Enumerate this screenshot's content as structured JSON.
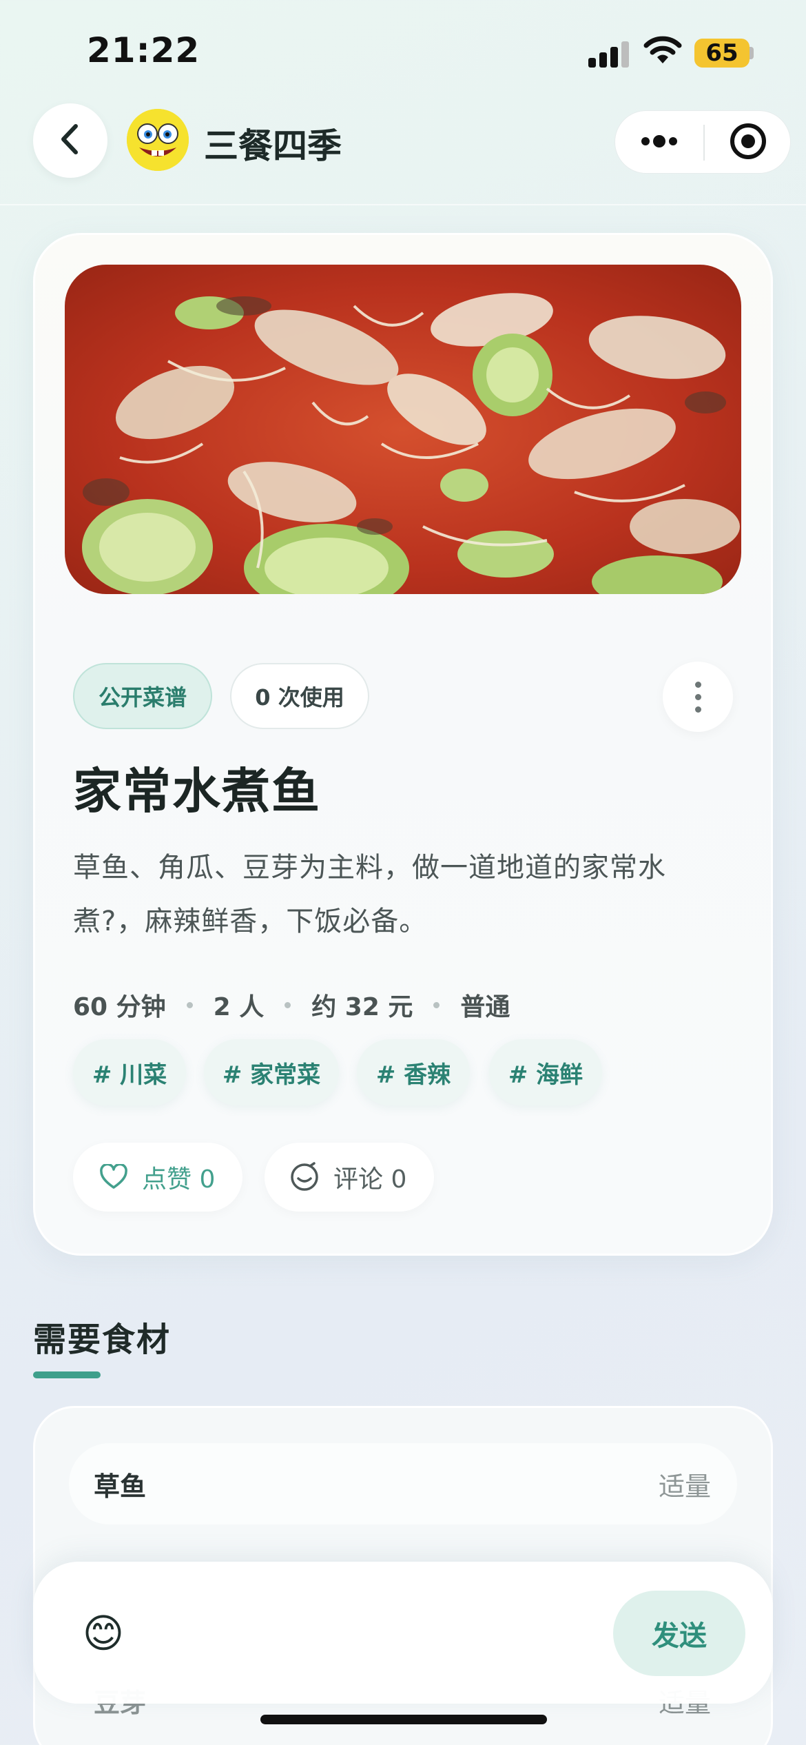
{
  "status_bar": {
    "time": "21:22",
    "battery": "65"
  },
  "nav": {
    "title": "三餐四季",
    "back_icon": "chevron-left-icon",
    "more_icon": "ellipsis-icon",
    "close_icon": "target-icon"
  },
  "recipe": {
    "visibility_badge": "公开菜谱",
    "usage_badge": "0 次使用",
    "title": "家常水煮鱼",
    "description": "草鱼、角瓜、豆芽为主料，做一道地道的家常水煮?，麻辣鲜香，下饭必备。",
    "meta": {
      "time": "60 分钟",
      "servings": "2 人",
      "cost": "约 32 元",
      "difficulty": "普通"
    },
    "tags": [
      "# 川菜",
      "# 家常菜",
      "# 香辣",
      "# 海鲜"
    ],
    "like_label": "点赞 0",
    "comment_label": "评论 0"
  },
  "ingredients": {
    "title": "需要食材",
    "items": [
      {
        "name": "草鱼",
        "amount": "适量"
      },
      {
        "name": "豆芽",
        "amount": "适量"
      }
    ]
  },
  "comment_bar": {
    "emoji": "😊",
    "placeholder": "",
    "send_label": "发送"
  },
  "colors": {
    "accent": "#3e9f8b",
    "accent_bg": "#dff1ec"
  }
}
